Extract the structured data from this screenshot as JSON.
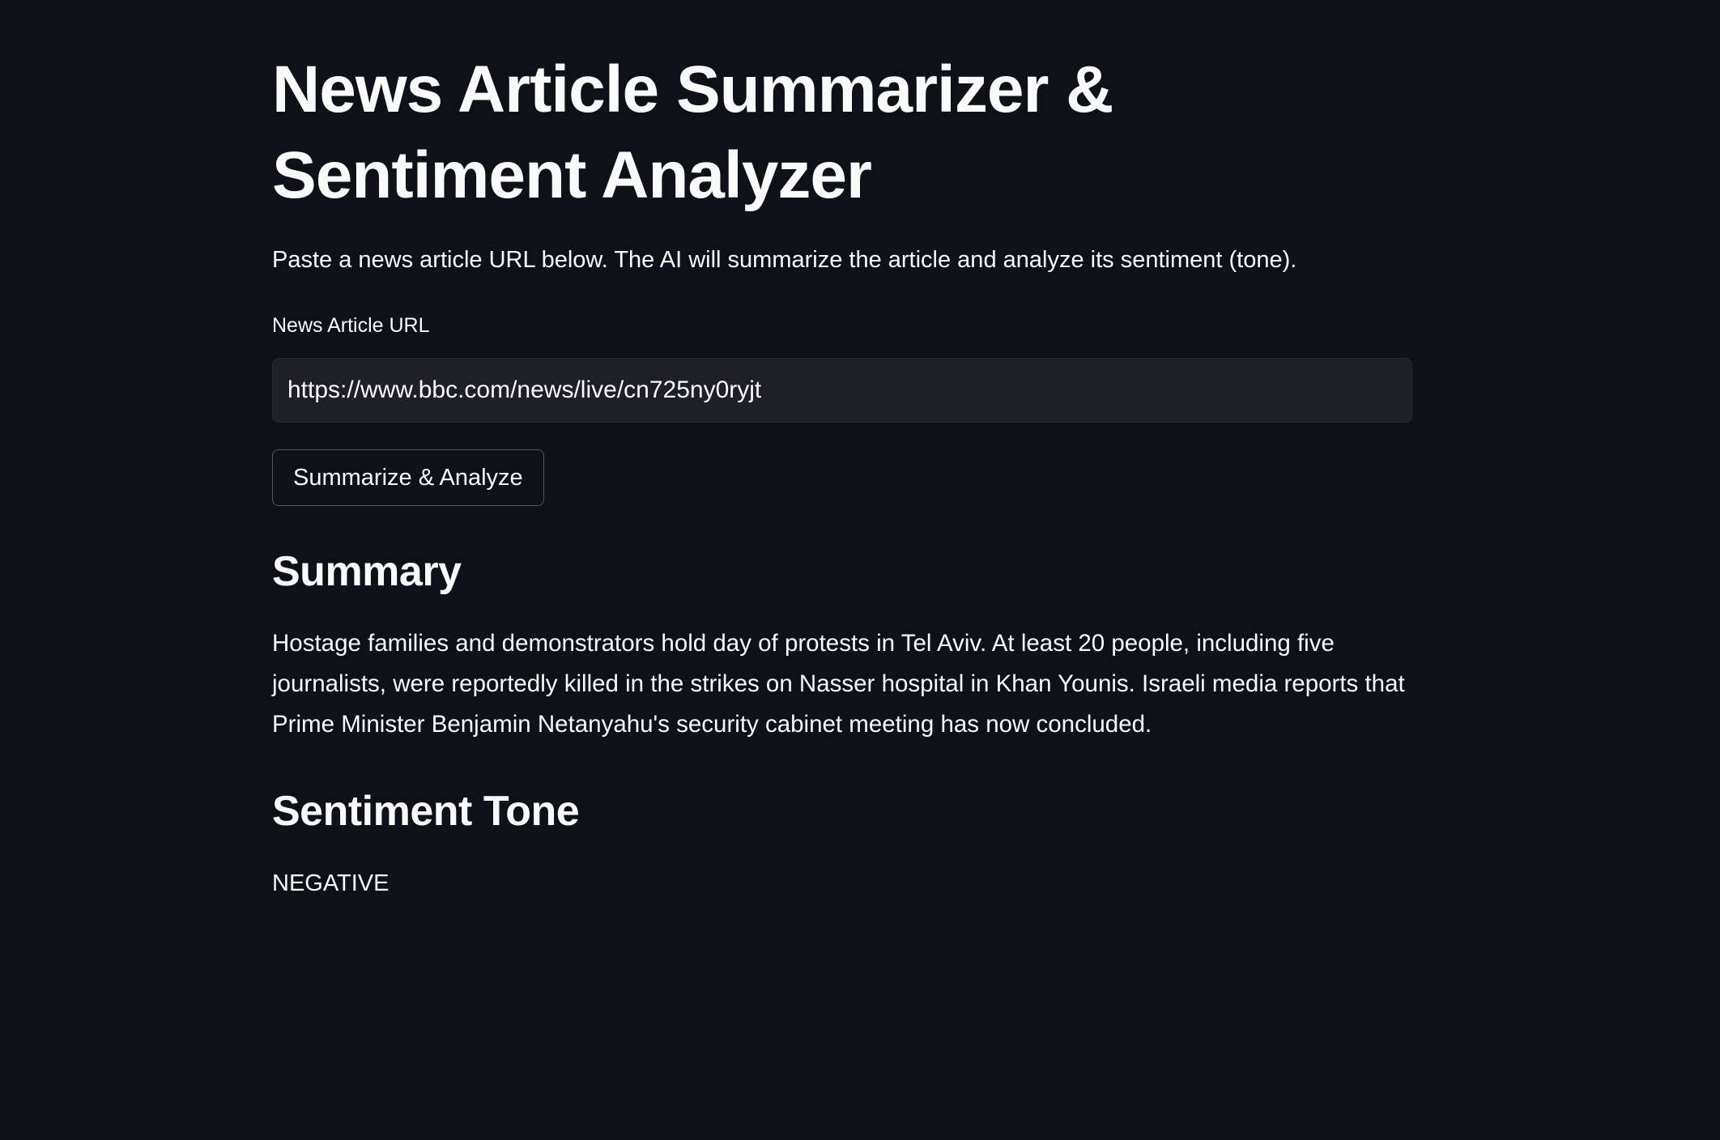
{
  "app": {
    "title": "News Article Summarizer & Sentiment Analyzer",
    "description": "Paste a news article URL below. The AI will summarize the article and analyze its sentiment (tone)."
  },
  "url_field": {
    "label": "News Article URL",
    "value": "https://www.bbc.com/news/live/cn725ny0ryjt"
  },
  "actions": {
    "submit_label": "Summarize & Analyze"
  },
  "summary": {
    "heading": "Summary",
    "text": "Hostage families and demonstrators hold day of protests in Tel Aviv. At least 20 people, including five journalists, were reportedly killed in the strikes on Nasser hospital in Khan Younis. Israeli media reports that Prime Minister Benjamin Netanyahu's security cabinet meeting has now concluded."
  },
  "sentiment": {
    "heading": "Sentiment Tone",
    "value": "NEGATIVE"
  },
  "colors": {
    "background": "#0e1117",
    "input_background": "#1f2027",
    "text": "#fafafa"
  }
}
